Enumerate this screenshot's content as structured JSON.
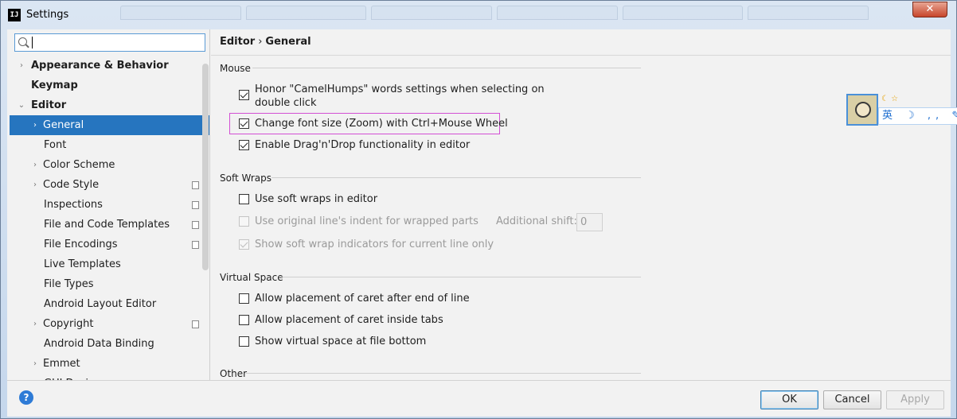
{
  "window": {
    "title": "Settings",
    "close_label": "✕",
    "app_icon_label": "IJ"
  },
  "search": {
    "value": "",
    "placeholder": ""
  },
  "sidebar": {
    "items": [
      {
        "label": "Appearance & Behavior",
        "arrow": "›"
      },
      {
        "label": "Keymap",
        "arrow": ""
      },
      {
        "label": "Editor",
        "arrow": "⌄"
      },
      {
        "label": "General",
        "arrow": "›"
      },
      {
        "label": "Font",
        "arrow": ""
      },
      {
        "label": "Color Scheme",
        "arrow": "›"
      },
      {
        "label": "Code Style",
        "arrow": "›"
      },
      {
        "label": "Inspections",
        "arrow": ""
      },
      {
        "label": "File and Code Templates",
        "arrow": ""
      },
      {
        "label": "File Encodings",
        "arrow": ""
      },
      {
        "label": "Live Templates",
        "arrow": ""
      },
      {
        "label": "File Types",
        "arrow": ""
      },
      {
        "label": "Android Layout Editor",
        "arrow": ""
      },
      {
        "label": "Copyright",
        "arrow": "›"
      },
      {
        "label": "Android Data Binding",
        "arrow": ""
      },
      {
        "label": "Emmet",
        "arrow": "›"
      },
      {
        "label": "GUI Designer",
        "arrow": ""
      }
    ]
  },
  "breadcrumb": {
    "parent": "Editor",
    "separator": "›",
    "current": "General"
  },
  "mouse": {
    "title": "Mouse",
    "camelhumps_line1": "Honor \"CamelHumps\" words settings when selecting on",
    "camelhumps_line2": "double click",
    "zoom": "Change font size (Zoom) with Ctrl+Mouse Wheel",
    "dragdrop": "Enable Drag'n'Drop functionality in editor"
  },
  "soft_wraps": {
    "title": "Soft Wraps",
    "use_soft_wraps": "Use soft wraps in editor",
    "original_indent": "Use original line's indent for wrapped parts",
    "additional_shift_label": "Additional shift:",
    "additional_shift_value": "0",
    "show_indicators": "Show soft wrap indicators for current line only"
  },
  "virtual_space": {
    "title": "Virtual Space",
    "after_end": "Allow placement of caret after end of line",
    "inside_tabs": "Allow placement of caret inside tabs",
    "file_bottom": "Show virtual space at file bottom"
  },
  "other": {
    "title": "Other"
  },
  "footer": {
    "help": "?",
    "ok": "OK",
    "cancel": "Cancel",
    "apply": "Apply"
  },
  "ime": {
    "badges": "☾ ☆",
    "bar": "英 ☽ ,, ✎ ▤"
  },
  "colors": {
    "selection": "#2675bf",
    "highlight_border": "#d24fd4",
    "help_blue": "#2e7bd6"
  }
}
